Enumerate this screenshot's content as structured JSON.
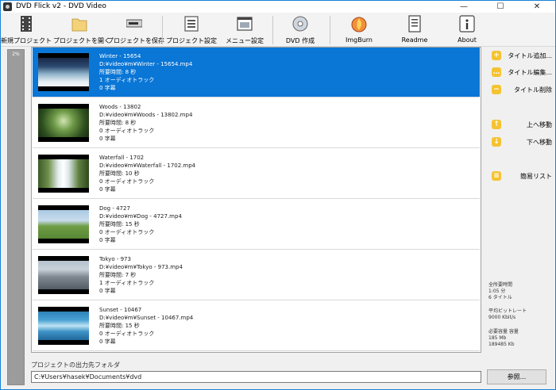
{
  "window": {
    "title": "DVD Flick v2 - DVD Video",
    "controls": {
      "minimize": "—",
      "maximize": "☐",
      "close": "✕"
    }
  },
  "toolbar": {
    "buttons": [
      {
        "label": "新規プロジェクト",
        "icon": "film-strip-icon"
      },
      {
        "label": "プロジェクトを開く",
        "icon": "folder-icon"
      },
      {
        "label": "プロジェクトを保存",
        "icon": "drive-icon"
      },
      {
        "label": "プロジェクト設定",
        "icon": "settings-dialog-icon"
      },
      {
        "label": "メニュー設定",
        "icon": "menu-window-icon"
      },
      {
        "label": "DVD 作成",
        "icon": "disc-icon"
      },
      {
        "label": "ImgBurn",
        "icon": "flame-icon"
      },
      {
        "label": "Readme",
        "icon": "document-icon"
      },
      {
        "label": "About",
        "icon": "info-icon"
      }
    ]
  },
  "progress": {
    "text": "2%"
  },
  "titles": [
    {
      "name": "Winter - 15654",
      "path": "D:¥video¥m¥Winter - 15654.mp4",
      "duration": "所要時間: 8 秒",
      "audio": "1 オーディオトラック",
      "subs": "0 字幕",
      "selected": true
    },
    {
      "name": "Woods - 13802",
      "path": "D:¥video¥m¥Woods - 13802.mp4",
      "duration": "所要時間: 8 秒",
      "audio": "0 オーディオトラック",
      "subs": "0 字幕",
      "selected": false
    },
    {
      "name": "Waterfall - 1702",
      "path": "D:¥video¥m¥Waterfall - 1702.mp4",
      "duration": "所要時間: 10 秒",
      "audio": "0 オーディオトラック",
      "subs": "0 字幕",
      "selected": false
    },
    {
      "name": "Dog - 4727",
      "path": "D:¥video¥m¥Dog - 4727.mp4",
      "duration": "所要時間: 15 秒",
      "audio": "0 オーディオトラック",
      "subs": "0 字幕",
      "selected": false
    },
    {
      "name": "Tokyo - 973",
      "path": "D:¥video¥m¥Tokyo - 973.mp4",
      "duration": "所要時間: 7 秒",
      "audio": "1 オーディオトラック",
      "subs": "0 字幕",
      "selected": false
    },
    {
      "name": "Sunset - 10467",
      "path": "D:¥video¥m¥Sunset - 10467.mp4",
      "duration": "所要時間: 15 秒",
      "audio": "0 オーディオトラック",
      "subs": "0 字幕",
      "selected": false
    }
  ],
  "side": {
    "add_title": "タイトル追加...",
    "edit_title": "タイトル編集...",
    "delete_title": "タイトル削除",
    "move_up": "上へ移動",
    "move_down": "下へ移動",
    "easy_list": "簡易リスト",
    "icons": {
      "add": "+",
      "edit": "…",
      "delete": "−",
      "up": "↑",
      "down": "↓",
      "list": "≡"
    }
  },
  "stats": {
    "total_time_label": "全所要時間",
    "total_time": "1:05 分",
    "title_count": "6 タイトル",
    "bitrate_label": "平均ビットレート",
    "bitrate": "9000 Kbit/s",
    "capacity_label": "必要容量 容量",
    "capacity_mb": "185 Mb",
    "capacity_kb": "189485 Kb"
  },
  "output": {
    "label": "プロジェクトの出力先フォルダ",
    "path": "C:¥Users¥hasek¥Documents¥dvd",
    "browse": "参照..."
  },
  "colors": {
    "selection": "#0a76d6",
    "accent_icon": "#f5c331",
    "window_border": "#1883d7"
  }
}
